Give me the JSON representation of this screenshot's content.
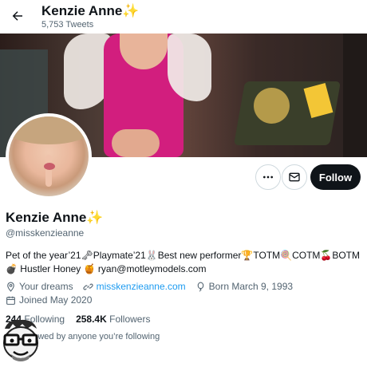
{
  "header": {
    "back_label": "←",
    "title": "Kenzie Anne",
    "title_emoji": "✨",
    "tweets": "5,753 Tweets"
  },
  "actions": {
    "more_label": "•••",
    "message_label": "✉",
    "follow_label": "Follow"
  },
  "profile": {
    "name": "Kenzie Anne",
    "name_emoji": "✨",
    "handle": "@misskenzieanne",
    "bio_line1": "Pet of the year’21🗝Playmate’21🐰Best new performer🏆TOTM🍭COTM🍒BOTM",
    "bio_line2": "💣 Hustler Honey 🍯 ryan@motleymodels.com",
    "location": "Your dreams",
    "website": "misskenzieanne.com",
    "birthday": "Born March 9, 1993",
    "joined": "Joined May 2020"
  },
  "stats": {
    "following_count": "244",
    "following_label": "Following",
    "followers_count": "258.4K",
    "followers_label": "Followers",
    "followed_by": "Not followed by anyone you’re following"
  },
  "colors": {
    "accent": "#1d9bf0",
    "text": "#0f1419",
    "secondary": "#536471",
    "follow_bg": "#0f1419"
  }
}
